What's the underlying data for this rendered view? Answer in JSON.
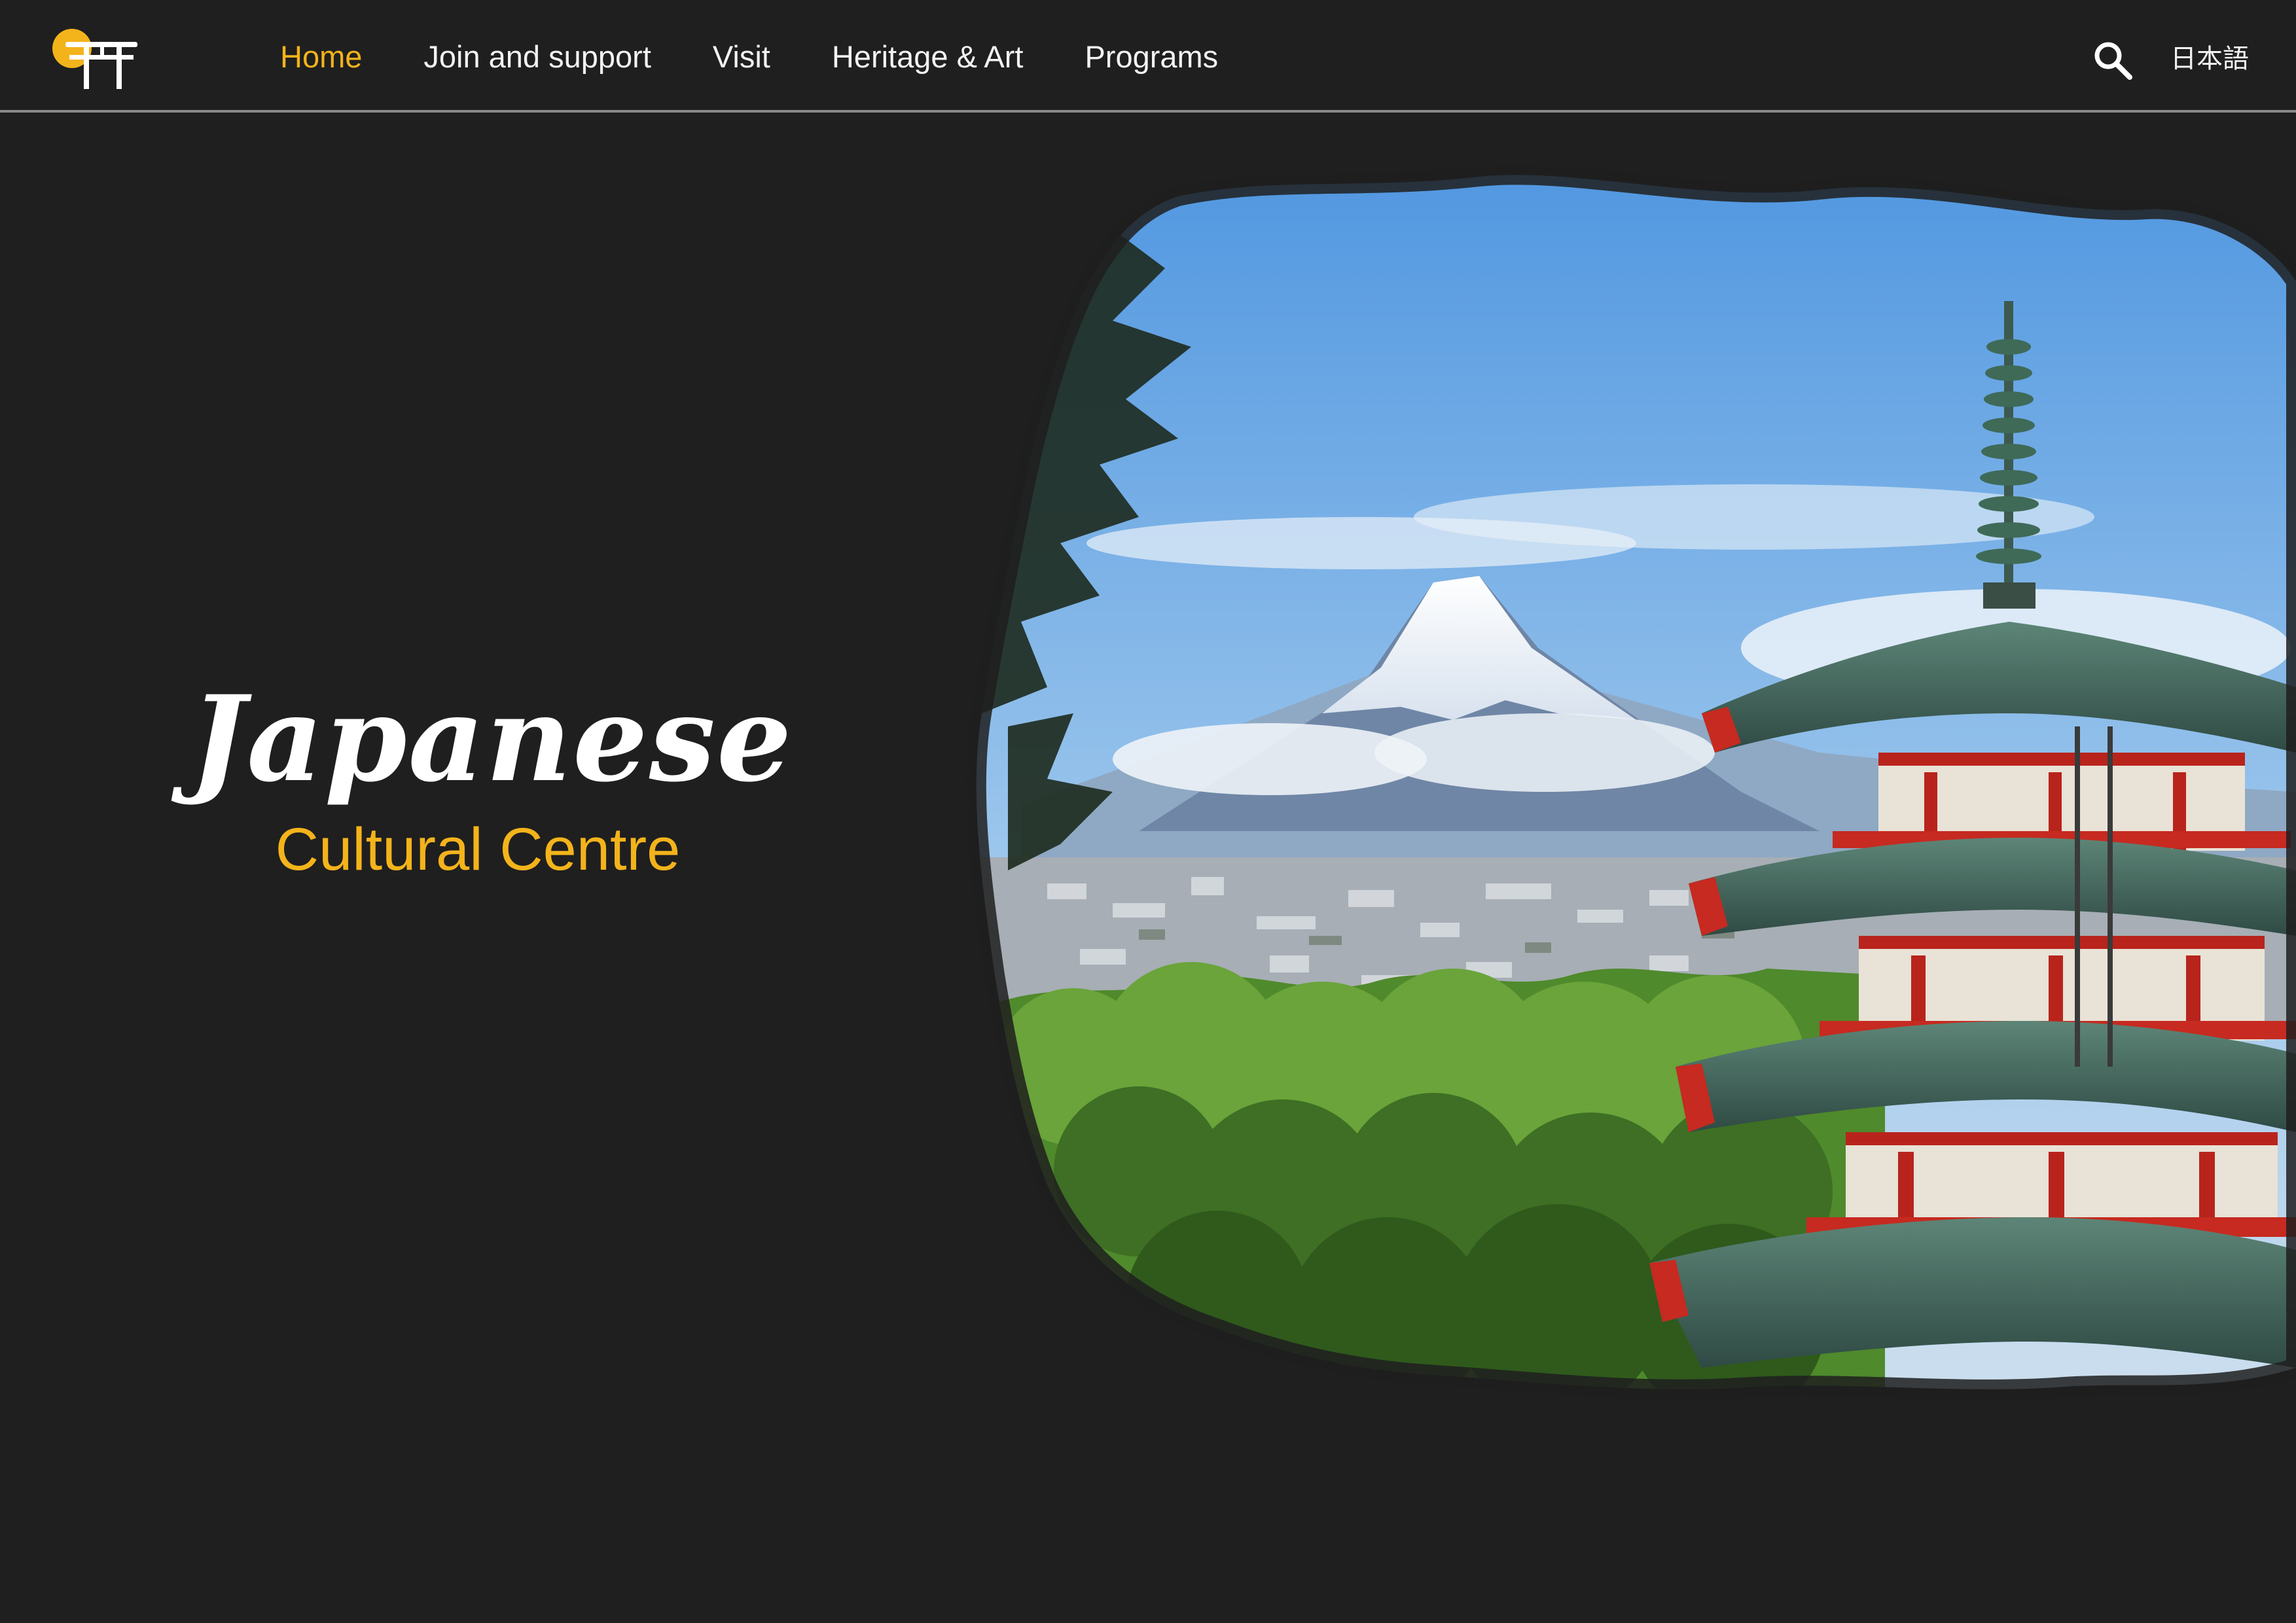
{
  "header": {
    "logo_icon": "torii-gate-sun-icon",
    "nav": [
      {
        "label": "Home",
        "active": true
      },
      {
        "label": "Join and support",
        "active": false
      },
      {
        "label": "Visit",
        "active": false
      },
      {
        "label": "Heritage & Art",
        "active": false
      },
      {
        "label": "Programs",
        "active": false
      }
    ],
    "search_icon": "search-icon",
    "language_label": "日本語"
  },
  "hero": {
    "title": "Japanese",
    "subtitle": "Cultural Centre",
    "image": "mount-fuji-pagoda-photo"
  },
  "colors": {
    "background": "#1f1f1f",
    "accent": "#f3b31b",
    "text": "#f2f2f2",
    "divider": "#8a8a8a"
  }
}
